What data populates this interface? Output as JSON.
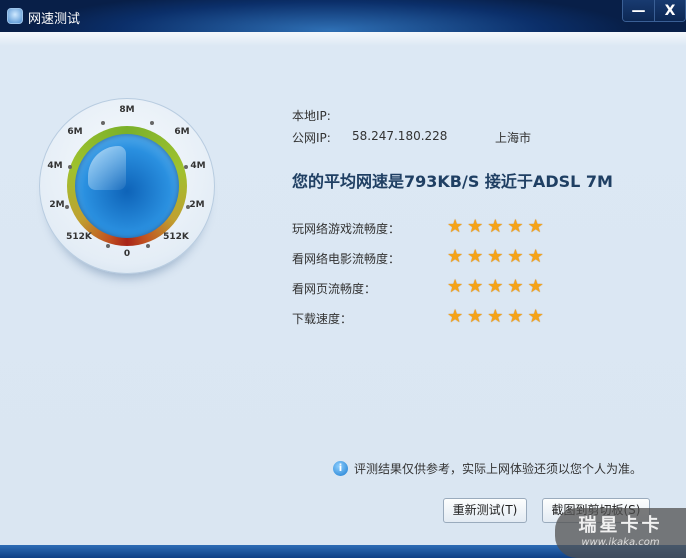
{
  "window": {
    "title": "网速测试",
    "minimize": "—",
    "close": "X"
  },
  "gauge": {
    "ticks": [
      "8M",
      "6M",
      "6M",
      "4M",
      "4M",
      "2M",
      "2M",
      "512K",
      "512K",
      "0"
    ],
    "colors": {
      "low": "#a82418",
      "mid": "#c0a030",
      "high": "#7ab02a",
      "ball": "#1a7ad0"
    }
  },
  "ip": {
    "local_label": "本地IP:",
    "local_value": "",
    "public_label": "公网IP:",
    "public_value": "58.247.180.228",
    "location": "上海市"
  },
  "headline": "您的平均网速是793KB/S 接近于ADSL 7M",
  "ratings": [
    {
      "label": "玩网络游戏流畅度：",
      "stars": 5,
      "max": 5
    },
    {
      "label": "看网络电影流畅度：",
      "stars": 5,
      "max": 5
    },
    {
      "label": "看网页流畅度：",
      "stars": 5,
      "max": 5
    },
    {
      "label": "下载速度：",
      "stars": 5,
      "max": 5
    }
  ],
  "note": {
    "icon": "info-icon",
    "text": "评测结果仅供参考，实际上网体验还须以您个人为准。"
  },
  "buttons": {
    "retest": "重新测试(T)",
    "copy": "截图到剪切板(S)"
  },
  "watermark": {
    "line1": "瑞星卡卡",
    "line2": "www.ikaka.com"
  }
}
